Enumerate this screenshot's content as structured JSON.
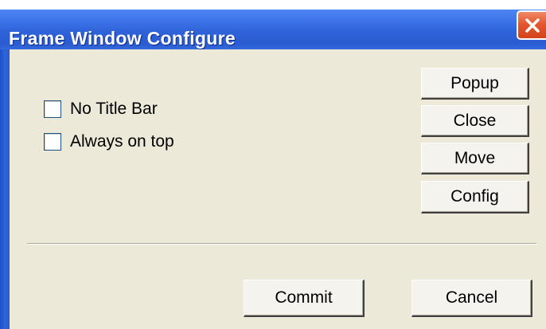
{
  "window": {
    "title": "Frame Window Configure"
  },
  "checkboxes": [
    {
      "label": "No Title Bar",
      "checked": false
    },
    {
      "label": "Always on top",
      "checked": false
    }
  ],
  "side_buttons": [
    {
      "label": "Popup"
    },
    {
      "label": "Close"
    },
    {
      "label": "Move"
    },
    {
      "label": "Config"
    }
  ],
  "footer_buttons": {
    "commit": "Commit",
    "cancel": "Cancel"
  },
  "colors": {
    "titlebar": "#2f63d9",
    "close_button": "#e4582f",
    "client_bg": "#ece9d8"
  }
}
